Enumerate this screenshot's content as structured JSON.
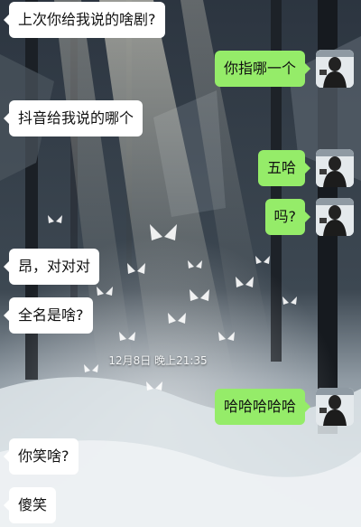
{
  "messages": [
    {
      "side": "in",
      "text": "上次你给我说的啥剧?"
    },
    {
      "side": "out",
      "text": "你指哪一个"
    },
    {
      "side": "in",
      "text": "抖音给我说的哪个"
    },
    {
      "side": "out",
      "text": "五哈"
    },
    {
      "side": "out",
      "text": "吗?"
    },
    {
      "side": "in",
      "text": "昂，对对对"
    },
    {
      "side": "in",
      "text": "全名是啥?"
    },
    {
      "side": "out",
      "text": "哈哈哈哈哈"
    },
    {
      "side": "in",
      "text": "你笑啥?"
    },
    {
      "side": "in",
      "text": "傻笑"
    }
  ],
  "timestamp": "12月8日 晚上21:35",
  "colors": {
    "incoming_bubble": "#ffffff",
    "outgoing_bubble": "#95ec69"
  },
  "icons": {
    "avatar": "user-avatar-icon"
  }
}
